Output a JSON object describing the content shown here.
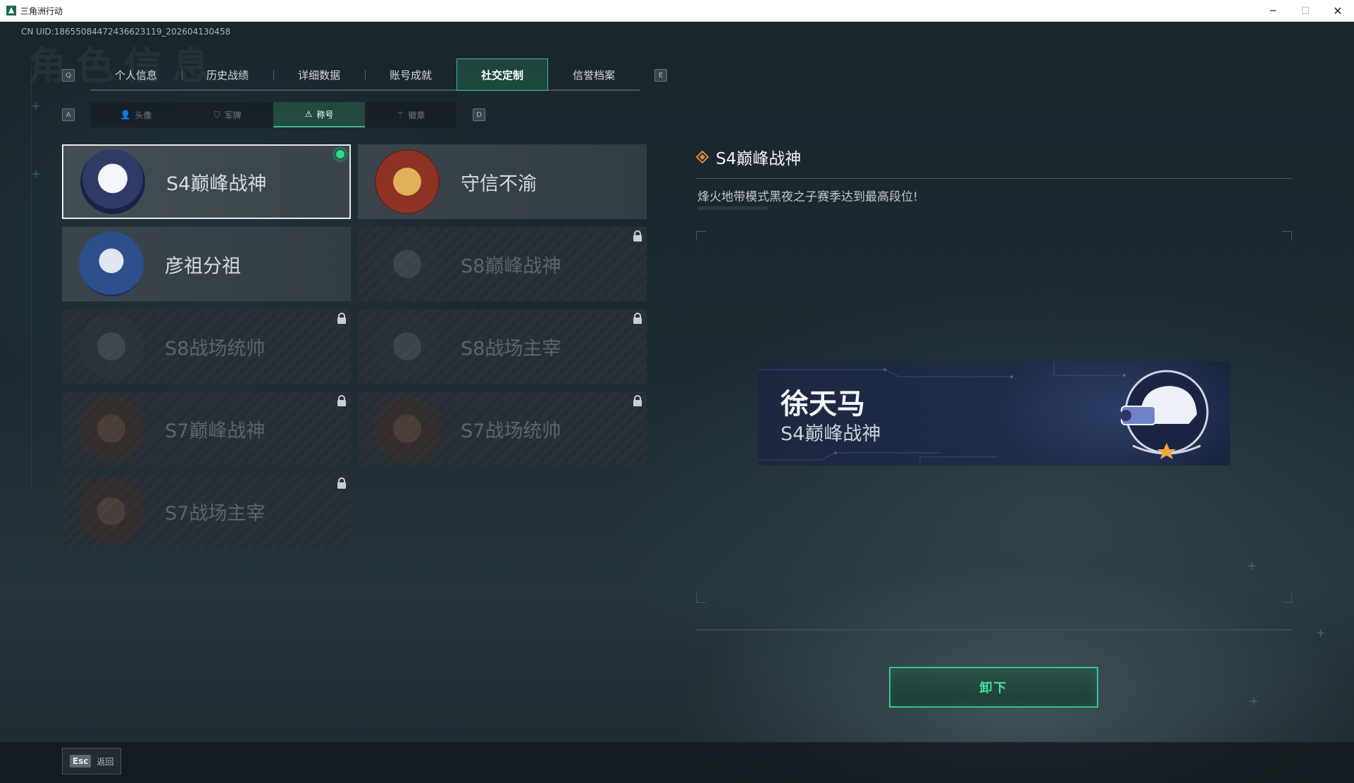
{
  "window": {
    "title": "三角洲行动",
    "minimize_glyph": "─",
    "maximize_glyph": "☐",
    "close_glyph": "✕"
  },
  "uid_text": "CN UID:18655084472436623119_202604130458",
  "watermark": "角色信息",
  "main_tabs": {
    "prev_key": "Q",
    "next_key": "E",
    "items": [
      {
        "label": "个人信息",
        "active": false
      },
      {
        "label": "历史战绩",
        "active": false
      },
      {
        "label": "详细数据",
        "active": false
      },
      {
        "label": "账号成就",
        "active": false
      },
      {
        "label": "社交定制",
        "active": true
      },
      {
        "label": "信誉档案",
        "active": false
      }
    ]
  },
  "sub_tabs": {
    "prev_key": "A",
    "next_key": "D",
    "items": [
      {
        "label": "头像",
        "icon": "person-icon",
        "glyph": "👤",
        "active": false
      },
      {
        "label": "军牌",
        "icon": "dogtag-icon",
        "glyph": "⛉",
        "active": false
      },
      {
        "label": "称号",
        "icon": "title-icon",
        "glyph": "⚠",
        "active": true
      },
      {
        "label": "徽章",
        "icon": "badge-icon",
        "glyph": "⚚",
        "active": false
      }
    ]
  },
  "titles": [
    {
      "label": "S4巅峰战神",
      "emblem": "helmet",
      "locked": false,
      "selected": true,
      "equipped": true
    },
    {
      "label": "守信不渝",
      "emblem": "scale",
      "locked": false,
      "selected": false,
      "equipped": false
    },
    {
      "label": "彦祖分祖",
      "emblem": "face",
      "locked": false,
      "selected": false,
      "equipped": false
    },
    {
      "label": "S8巅峰战神",
      "emblem": "dark1",
      "locked": true,
      "selected": false,
      "equipped": false
    },
    {
      "label": "S8战场统帅",
      "emblem": "dark2",
      "locked": true,
      "selected": false,
      "equipped": false
    },
    {
      "label": "S8战场主宰",
      "emblem": "dark1",
      "locked": true,
      "selected": false,
      "equipped": false
    },
    {
      "label": "S7巅峰战神",
      "emblem": "brown",
      "locked": true,
      "selected": false,
      "equipped": false
    },
    {
      "label": "S7战场统帅",
      "emblem": "brown",
      "locked": true,
      "selected": false,
      "equipped": false
    },
    {
      "label": "S7战场主宰",
      "emblem": "brown",
      "locked": true,
      "selected": false,
      "equipped": false
    }
  ],
  "detail": {
    "title": "S4巅峰战神",
    "description": "烽火地带模式黑夜之子赛季达到最高段位!"
  },
  "banner": {
    "player_name": "徐天马",
    "title": "S4巅峰战神"
  },
  "action_button": "卸下",
  "footer": {
    "esc_key": "Esc",
    "back_label": "返回"
  },
  "colors": {
    "accent_green": "#36c48e",
    "equipped_dot": "#35d58c",
    "background": "#1a2329"
  }
}
